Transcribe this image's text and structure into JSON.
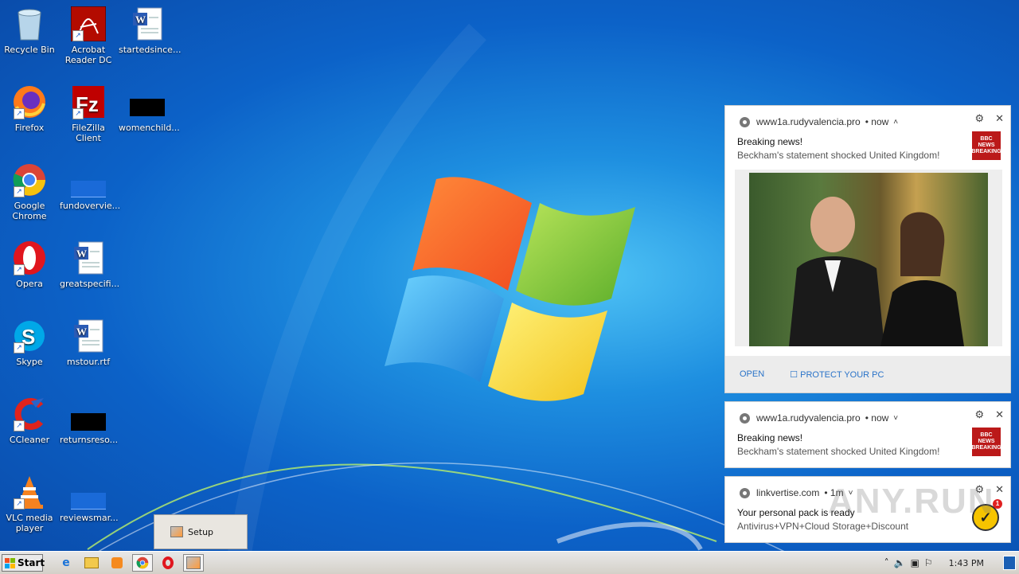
{
  "desktop": {
    "icons": [
      {
        "label": "Recycle Bin",
        "icon": "recycle-bin-icon"
      },
      {
        "label": "Acrobat Reader DC",
        "icon": "acrobat-icon"
      },
      {
        "label": "startedsince...",
        "icon": "word-doc-icon"
      },
      {
        "label": "Firefox",
        "icon": "firefox-icon"
      },
      {
        "label": "FileZilla Client",
        "icon": "filezilla-icon"
      },
      {
        "label": "womenchild...",
        "icon": "black-file-icon"
      },
      {
        "label": "Google Chrome",
        "icon": "chrome-icon"
      },
      {
        "label": "fundovervie...",
        "icon": "blue-file-icon"
      },
      {
        "label": "Opera",
        "icon": "opera-icon"
      },
      {
        "label": "greatspecifi...",
        "icon": "word-doc-icon"
      },
      {
        "label": "Skype",
        "icon": "skype-icon"
      },
      {
        "label": "mstour.rtf",
        "icon": "word-doc-icon"
      },
      {
        "label": "CCleaner",
        "icon": "ccleaner-icon"
      },
      {
        "label": "returnsreso...",
        "icon": "black-file-icon"
      },
      {
        "label": "VLC media player",
        "icon": "vlc-icon"
      },
      {
        "label": "reviewsmar...",
        "icon": "blue-file-icon"
      }
    ]
  },
  "notifications": [
    {
      "site": "www1a.rudyvalencia.pro",
      "time": "• now",
      "title": "Breaking news!",
      "body": "Beckham's statement shocked United Kingdom!",
      "badge": "BBC NEWS BREAKING",
      "actions": [
        "OPEN",
        "PROTECT YOUR PC"
      ]
    },
    {
      "site": "www1a.rudyvalencia.pro",
      "time": "• now",
      "title": "Breaking news!",
      "body": "Beckham's statement shocked United Kingdom!",
      "badge": "BBC NEWS BREAKING"
    },
    {
      "site": "linkvertise.com",
      "time": "• 1m",
      "title": "Your personal pack is ready",
      "body": "Antivirus+VPN+Cloud Storage+Discount",
      "badge_count": "1"
    }
  ],
  "setup_popup": {
    "label": "Setup"
  },
  "taskbar": {
    "start_label": "Start",
    "clock": "1:43 PM"
  },
  "watermark": "ANY.RUN"
}
